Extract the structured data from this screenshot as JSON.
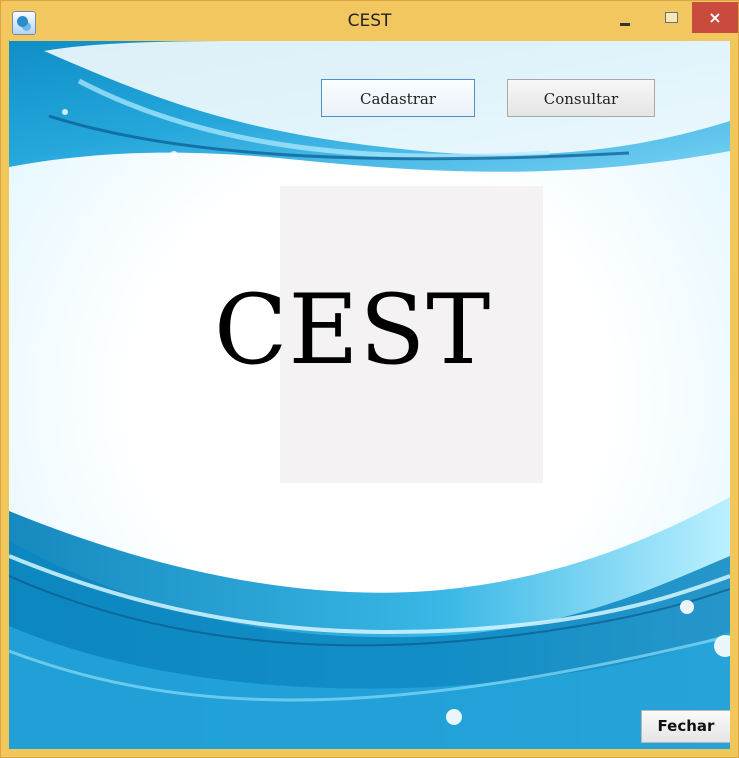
{
  "window": {
    "title": "CEST",
    "controls": {
      "minimize": "minimize",
      "maximize": "maximize",
      "close": "×"
    },
    "icon": "app-icon"
  },
  "main": {
    "buttons": {
      "cadastrar": "Cadastrar",
      "consultar": "Consultar",
      "fechar": "Fechar"
    },
    "logo_text": "CEST"
  },
  "colors": {
    "titlebar": "#f2c75f",
    "close": "#c84b3d",
    "accent_blue": "#1f9fd1"
  }
}
